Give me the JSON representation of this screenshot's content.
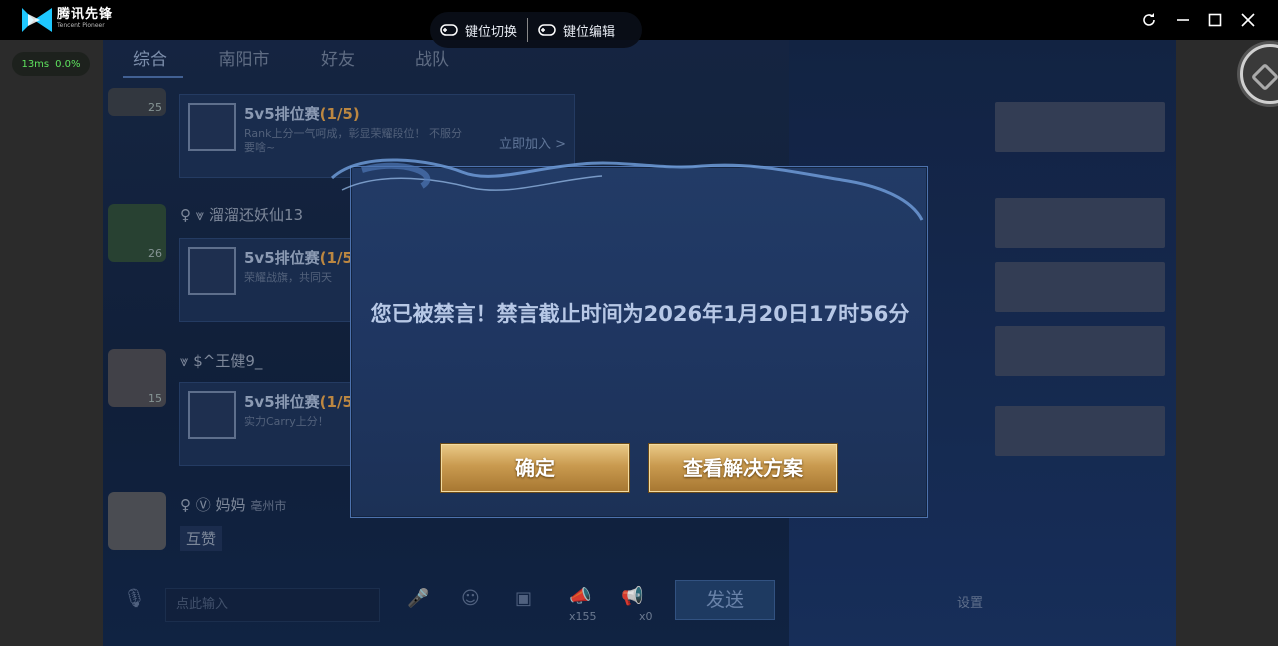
{
  "app": {
    "brand_cn": "腾讯先锋",
    "brand_en": "Tencent Pioneer"
  },
  "status": {
    "ping": "13ms",
    "loss": "0.0%"
  },
  "tabs": [
    "综合",
    "南阳市",
    "好友",
    "战队"
  ],
  "overlay": {
    "key_switch": "键位切换",
    "key_edit": "键位编辑"
  },
  "chat": {
    "messages": [
      {
        "level": "25",
        "card_title": "5v5排位赛",
        "card_count": "(1/5)",
        "card_desc": "Rank上分一气呵成，彰显荣耀段位！ 不服分要啥~",
        "join": "立即加入 >"
      },
      {
        "level": "26",
        "name": "溜溜还妖仙13",
        "card_title": "5v5排位赛",
        "card_count": "(1/5",
        "card_desc": "荣耀战旗，共同天"
      },
      {
        "level": "15",
        "name": "$^王健9_",
        "card_title": "5v5排位赛",
        "card_count": "(1/5",
        "card_desc": "实力Carry上分！"
      },
      {
        "name": "妈妈",
        "location": "亳州市",
        "text": "互赞"
      }
    ],
    "input_placeholder": "点此输入",
    "send": "发送",
    "count_1": "x155",
    "count_2": "x0"
  },
  "dialog": {
    "message": "您已被禁言！禁言截止时间为2026年1月20日17时56分",
    "ok": "确定",
    "solution": "查看解决方案"
  },
  "right_panel": {
    "label": "设置"
  }
}
